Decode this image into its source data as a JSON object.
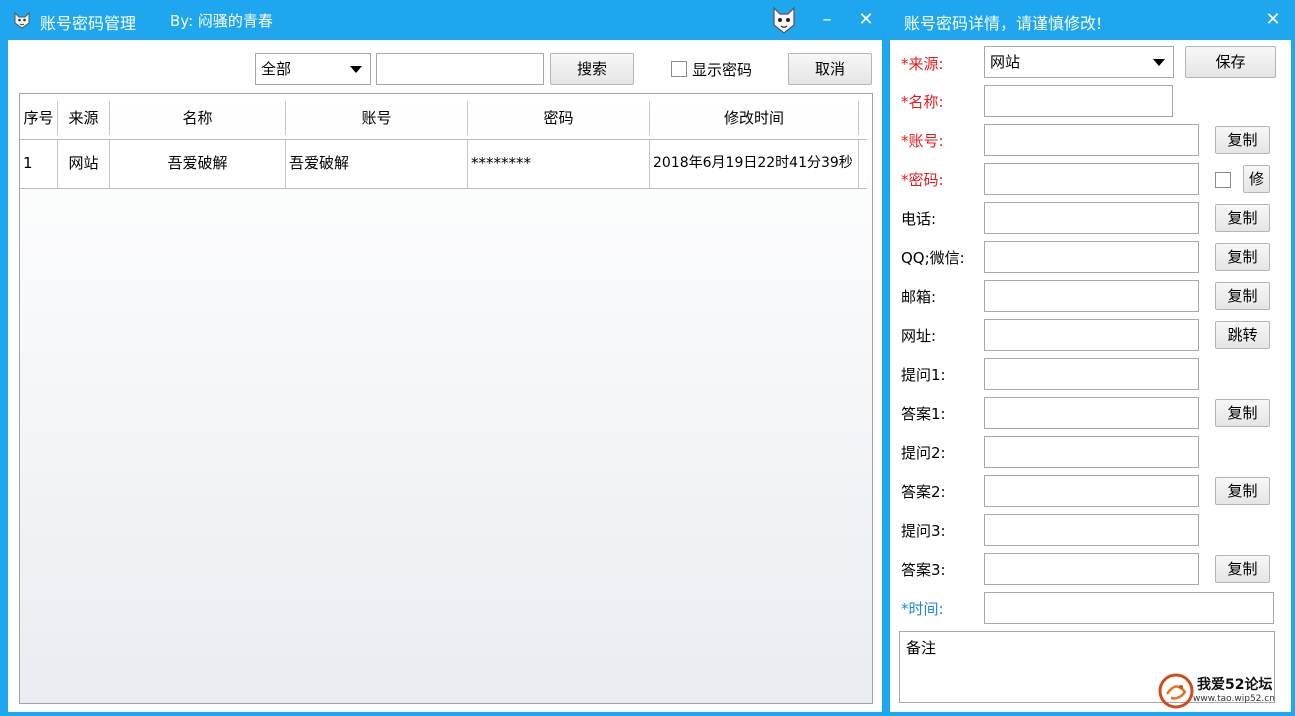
{
  "main_window": {
    "title": "账号密码管理",
    "author": "By: 闷骚的青春",
    "minimize_glyph": "–",
    "close_glyph": "✕",
    "toolbar": {
      "filter_value": "全部",
      "search_value": "",
      "search_label": "搜索",
      "show_password_label": "显示密码",
      "cancel_label": "取消"
    },
    "table": {
      "headers": [
        "序号",
        "来源",
        "名称",
        "账号",
        "密码",
        "修改时间"
      ],
      "rows": [
        [
          "1",
          "网站",
          "吾爱破解",
          "吾爱破解",
          "********",
          "2018年6月19日22时41分39秒"
        ]
      ]
    }
  },
  "detail_window": {
    "title": "账号密码详情，请谨慎修改!",
    "close_glyph": "✕",
    "fields": {
      "source_label": "*来源:",
      "source_value": "网站",
      "save_label": "保存",
      "name_label": "*名称:",
      "account_label": "*账号:",
      "password_label": "*密码:",
      "phone_label": "电话:",
      "qq_label": "QQ;微信:",
      "email_label": "邮箱:",
      "url_label": "网址:",
      "q1_label": "提问1:",
      "a1_label": "答案1:",
      "q2_label": "提问2:",
      "a2_label": "答案2:",
      "q3_label": "提问3:",
      "a3_label": "答案3:",
      "time_label": "*时间:",
      "memo_value": "备注"
    },
    "buttons": {
      "copy_label": "复制",
      "modify_label": "修",
      "jump_label": "跳转"
    }
  },
  "watermark": {
    "text": "我爱52论坛",
    "url": "www.tao.wip52.cn"
  },
  "colors": {
    "title_bar": "#1ea7ee",
    "required": "#e81b1b",
    "time_label": "#1e86e0"
  },
  "icons": [
    "cat-app-icon",
    "cat-mascot-icon",
    "minimize-icon",
    "close-icon",
    "dropdown-arrow-icon",
    "checkbox-icon"
  ]
}
